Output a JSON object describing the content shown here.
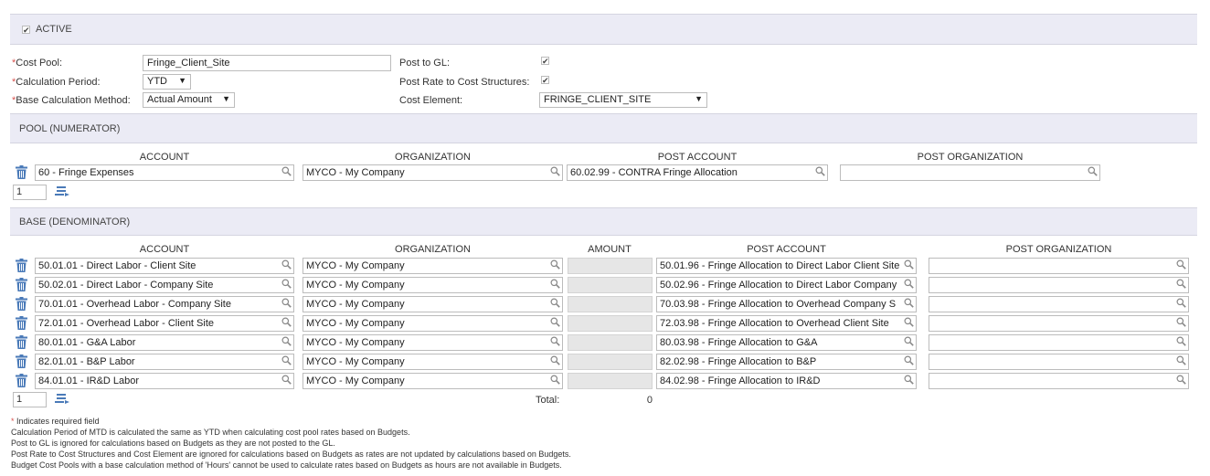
{
  "header": {
    "active_label": "ACTIVE",
    "active_checked": "✔"
  },
  "form": {
    "cost_pool_label": "Cost Pool:",
    "cost_pool_value": "Fringe_Client_Site",
    "calc_period_label": "Calculation Period:",
    "calc_period_value": "YTD",
    "base_method_label": "Base Calculation Method:",
    "base_method_value": "Actual Amount",
    "post_gl_label": "Post to GL:",
    "post_rate_label": "Post Rate to Cost Structures:",
    "cost_element_label": "Cost Element:",
    "cost_element_value": "FRINGE_CLIENT_SITE",
    "required_mark": "*",
    "check_glyph": "✔"
  },
  "pool": {
    "title": "POOL (NUMERATOR)",
    "headers": {
      "account": "ACCOUNT",
      "organization": "ORGANIZATION",
      "post_account": "POST ACCOUNT",
      "post_organization": "POST ORGANIZATION"
    },
    "rows": [
      {
        "account": "60 - Fringe Expenses",
        "organization": "MYCO - My Company",
        "post_account": "60.02.99 - CONTRA Fringe Allocation",
        "post_organization": ""
      }
    ],
    "page": "1"
  },
  "base": {
    "title": "BASE (DENOMINATOR)",
    "headers": {
      "account": "ACCOUNT",
      "organization": "ORGANIZATION",
      "amount": "AMOUNT",
      "post_account": "POST ACCOUNT",
      "post_organization": "POST ORGANIZATION"
    },
    "rows": [
      {
        "account": "50.01.01 - Direct Labor - Client Site",
        "organization": "MYCO - My Company",
        "post_account": "50.01.96 - Fringe Allocation to Direct Labor Client Site",
        "post_organization": ""
      },
      {
        "account": "50.02.01 - Direct Labor - Company Site",
        "organization": "MYCO - My Company",
        "post_account": "50.02.96 - Fringe Allocation to Direct Labor Company",
        "post_organization": ""
      },
      {
        "account": "70.01.01 - Overhead Labor - Company Site",
        "organization": "MYCO - My Company",
        "post_account": "70.03.98 - Fringe Allocation to Overhead Company S",
        "post_organization": ""
      },
      {
        "account": "72.01.01 - Overhead Labor - Client Site",
        "organization": "MYCO - My Company",
        "post_account": "72.03.98 - Fringe Allocation to Overhead Client Site",
        "post_organization": ""
      },
      {
        "account": "80.01.01 - G&A Labor",
        "organization": "MYCO - My Company",
        "post_account": "80.03.98 - Fringe Allocation to G&A",
        "post_organization": ""
      },
      {
        "account": "82.01.01 - B&P Labor",
        "organization": "MYCO - My Company",
        "post_account": "82.02.98 - Fringe Allocation to B&P",
        "post_organization": ""
      },
      {
        "account": "84.01.01 - IR&D Labor",
        "organization": "MYCO - My Company",
        "post_account": "84.02.98 - Fringe Allocation to IR&D",
        "post_organization": ""
      }
    ],
    "page": "1",
    "total_label": "Total:",
    "total_value": "0"
  },
  "notes": {
    "required_mark": "*",
    "required_text": "Indicates required field",
    "lines": [
      "Calculation Period of MTD is calculated the same as YTD when calculating cost pool rates based on Budgets.",
      "Post to GL is ignored for calculations based on Budgets as they are not posted to the GL.",
      "Post Rate to Cost Structures and Cost Element are ignored for calculations based on Budgets as rates are not updated by calculations based on Budgets.",
      "Budget Cost Pools with a base calculation method of 'Hours' cannot be used to calculate rates based on Budgets as hours are not available in Budgets."
    ]
  },
  "colors": {
    "header_bg": "#ebebf5",
    "required": "#d9534f",
    "icon_blue": "#4a7ab8"
  }
}
